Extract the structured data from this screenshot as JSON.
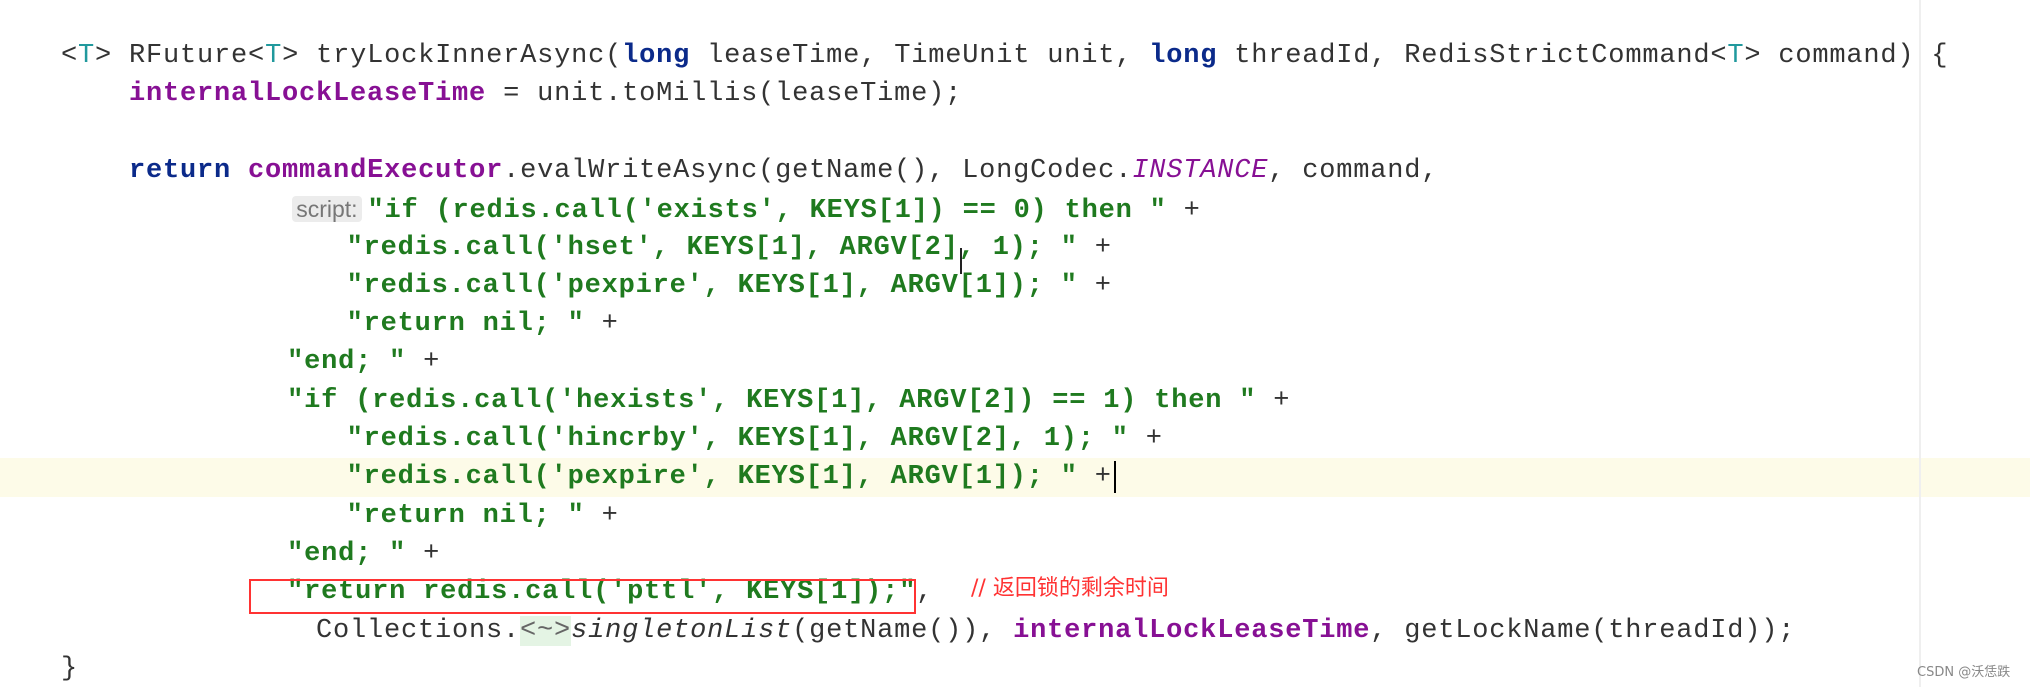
{
  "annotation": {
    "comment": "// 返回锁的剩余时间",
    "highlight_color": "#ff3333"
  },
  "watermark": "CSDN @沃恁跌",
  "code": {
    "current_line_index": 11,
    "lines": [
      {
        "indent": 0,
        "tokens": [
          [
            "<",
            "plain"
          ],
          [
            "T",
            "tparam"
          ],
          [
            "> RFuture<",
            "plain"
          ],
          [
            "T",
            "tparam"
          ],
          [
            "> tryLockInnerAsync(",
            "plain"
          ],
          [
            "long",
            "kw"
          ],
          [
            " leaseTime, TimeUnit unit, ",
            "plain"
          ],
          [
            "long",
            "kw"
          ],
          [
            " threadId, RedisStrictCommand<",
            "plain"
          ],
          [
            "T",
            "tparam"
          ],
          [
            "> command) {",
            "plain"
          ]
        ]
      },
      {
        "indent": 4,
        "tokens": [
          [
            "internalLockLeaseTime",
            "field"
          ],
          [
            " = unit.toMillis(leaseTime);",
            "plain"
          ]
        ]
      },
      {
        "indent": 0,
        "tokens": []
      },
      {
        "indent": 4,
        "tokens": [
          [
            "return",
            "kw"
          ],
          [
            " ",
            "plain"
          ],
          [
            "commandExecutor",
            "field"
          ],
          [
            ".evalWriteAsync(getName(), LongCodec.",
            "plain"
          ],
          [
            "INSTANCE",
            "static"
          ],
          [
            ", command,",
            "plain"
          ]
        ]
      },
      {
        "indent": 13.6,
        "hint": "script:",
        "tokens": [
          [
            "\"if (redis.call('exists', KEYS[1]) == 0) then \"",
            "str"
          ],
          [
            " +",
            "plain"
          ]
        ]
      },
      {
        "indent": 16.8,
        "tokens": [
          [
            "\"redis.call('hset', KEYS[1], ARGV[2], 1); \"",
            "str"
          ],
          [
            " +",
            "plain"
          ]
        ]
      },
      {
        "indent": 16.8,
        "tokens": [
          [
            "\"redis.call('pexpire', KEYS[1], ARGV[1]); \"",
            "str"
          ],
          [
            " +",
            "plain"
          ]
        ]
      },
      {
        "indent": 16.8,
        "tokens": [
          [
            "\"return nil; \"",
            "str"
          ],
          [
            " +",
            "plain"
          ]
        ]
      },
      {
        "indent": 13.3,
        "tokens": [
          [
            "\"end; \"",
            "str"
          ],
          [
            " +",
            "plain"
          ]
        ]
      },
      {
        "indent": 13.3,
        "tokens": [
          [
            "\"if (redis.call('hexists', KEYS[1], ARGV[2]) == 1) then \"",
            "str"
          ],
          [
            " +",
            "plain"
          ]
        ]
      },
      {
        "indent": 16.8,
        "tokens": [
          [
            "\"redis.call('hincrby', KEYS[1], ARGV[2], 1); \"",
            "str"
          ],
          [
            " +",
            "plain"
          ]
        ]
      },
      {
        "indent": 16.8,
        "tokens": [
          [
            "\"redis.call('pexpire', KEYS[1], ARGV[1]); \"",
            "str"
          ],
          [
            " +",
            "plain"
          ]
        ]
      },
      {
        "indent": 16.8,
        "tokens": [
          [
            "\"return nil; \"",
            "str"
          ],
          [
            " +",
            "plain"
          ]
        ]
      },
      {
        "indent": 13.3,
        "tokens": [
          [
            "\"end; \"",
            "str"
          ],
          [
            " +",
            "plain"
          ]
        ]
      },
      {
        "indent": 13.3,
        "tokens": [
          [
            "\"return redis.call('pttl', KEYS[1]);\"",
            "str"
          ],
          [
            ",",
            "plain"
          ]
        ]
      },
      {
        "indent": 15,
        "tokens": [
          [
            "Collections.",
            "plain"
          ],
          [
            "<~>",
            "fold"
          ],
          [
            "singletonList",
            "italic"
          ],
          [
            "(getName()), ",
            "plain"
          ],
          [
            "internalLockLeaseTime",
            "field"
          ],
          [
            ", getLockName(threadId));",
            "plain"
          ]
        ]
      },
      {
        "indent": 0,
        "tokens": [
          [
            "}",
            "plain"
          ]
        ]
      }
    ]
  }
}
